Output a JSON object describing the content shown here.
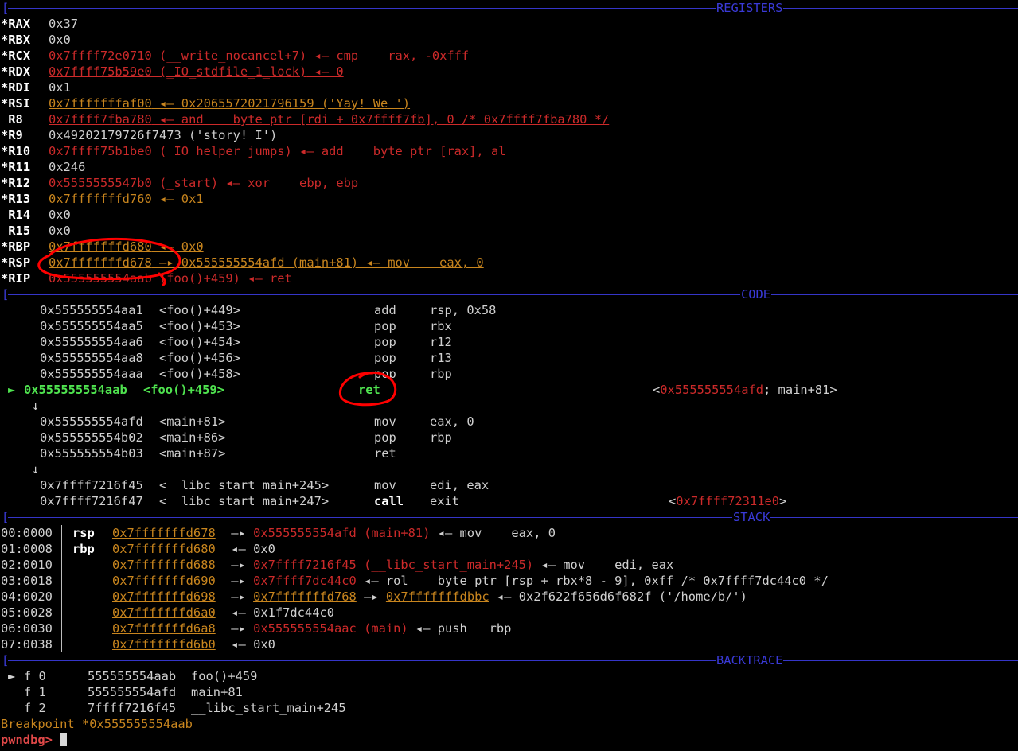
{
  "sections": {
    "registers": "REGISTERS",
    "code": "CODE",
    "stack": "STACK",
    "backtrace": "BACKTRACE"
  },
  "registers": [
    {
      "mod": "*",
      "name": "RAX",
      "value": "0x37",
      "vstyle": "plain",
      "rest": ""
    },
    {
      "mod": "*",
      "name": "RBX",
      "value": "0x0",
      "vstyle": "plain",
      "rest": ""
    },
    {
      "mod": "*",
      "name": "RCX",
      "value": "0x7ffff72e0710 (__write_nocancel+7)",
      "vstyle": "code",
      "rest": " ◂— cmp    rax, -0xfff"
    },
    {
      "mod": "*",
      "name": "RDX",
      "value": "0x7ffff75b59e0 (_IO_stdfile_1_lock)",
      "vstyle": "code-ul",
      "rest": " ◂— 0"
    },
    {
      "mod": "*",
      "name": "RDI",
      "value": "0x1",
      "vstyle": "plain",
      "rest": ""
    },
    {
      "mod": "*",
      "name": "RSI",
      "value": "0x7fffffffaf00",
      "vstyle": "stack",
      "rest": " ◂— 0x2065572021796159 ('Yay! We ')"
    },
    {
      "mod": " ",
      "name": "R8",
      "value": "0x7ffff7fba780",
      "vstyle": "code-ul",
      "rest": " ◂— and    byte ptr [rdi + 0x7ffff7fb], 0 /* 0x7ffff7fba780 */"
    },
    {
      "mod": "*",
      "name": "R9",
      "value": "0x49202179726f7473 ('story! I')",
      "vstyle": "plain",
      "rest": ""
    },
    {
      "mod": "*",
      "name": "R10",
      "value": "0x7ffff75b1be0 (_IO_helper_jumps)",
      "vstyle": "code",
      "rest": " ◂— add    byte ptr [rax], al"
    },
    {
      "mod": "*",
      "name": "R11",
      "value": "0x246",
      "vstyle": "plain",
      "rest": ""
    },
    {
      "mod": "*",
      "name": "R12",
      "value": "0x5555555547b0 (_start)",
      "vstyle": "code",
      "rest": " ◂— xor    ebp, ebp"
    },
    {
      "mod": "*",
      "name": "R13",
      "value": "0x7fffffffd760",
      "vstyle": "stack",
      "rest": " ◂— 0x1"
    },
    {
      "mod": " ",
      "name": "R14",
      "value": "0x0",
      "vstyle": "plain",
      "rest": ""
    },
    {
      "mod": " ",
      "name": "R15",
      "value": "0x0",
      "vstyle": "plain",
      "rest": ""
    },
    {
      "mod": "*",
      "name": "RBP",
      "value": "0x7fffffffd680",
      "vstyle": "stack",
      "rest": " ◂— 0x0"
    },
    {
      "mod": "*",
      "name": "RSP",
      "value": "0x7fffffffd678",
      "vstyle": "stack",
      "rest": " —▸ 0x555555554afd (main+81) ◂— mov    eax, 0"
    },
    {
      "mod": "*",
      "name": "RIP",
      "value": "0x555555554aab (foo()+459)",
      "vstyle": "code",
      "rest": " ◂— ret"
    }
  ],
  "code": [
    {
      "arrow": "",
      "addr": "0x555555554aa1",
      "sym": "<foo()+449>",
      "mnem": "add",
      "ops": "rsp, 0x58",
      "comment": ""
    },
    {
      "arrow": "",
      "addr": "0x555555554aa5",
      "sym": "<foo()+453>",
      "mnem": "pop",
      "ops": "rbx",
      "comment": ""
    },
    {
      "arrow": "",
      "addr": "0x555555554aa6",
      "sym": "<foo()+454>",
      "mnem": "pop",
      "ops": "r12",
      "comment": ""
    },
    {
      "arrow": "",
      "addr": "0x555555554aa8",
      "sym": "<foo()+456>",
      "mnem": "pop",
      "ops": "r13",
      "comment": ""
    },
    {
      "arrow": "",
      "addr": "0x555555554aaa",
      "sym": "<foo()+458>",
      "mnem": "pop",
      "ops": "rbp",
      "comment": ""
    },
    {
      "arrow": "►",
      "addr": "0x555555554aab",
      "sym": "<foo()+459>",
      "mnem": "ret",
      "ops": "",
      "comment_pre": "<",
      "comment_addr": "0x555555554afd",
      "comment_post": "; main+81>",
      "current": true
    },
    {
      "flow": "↓"
    },
    {
      "arrow": "",
      "addr": "0x555555554afd",
      "sym": "<main+81>",
      "mnem": "mov",
      "ops": "eax, 0",
      "comment": ""
    },
    {
      "arrow": "",
      "addr": "0x555555554b02",
      "sym": "<main+86>",
      "mnem": "pop",
      "ops": "rbp",
      "comment": ""
    },
    {
      "arrow": "",
      "addr": "0x555555554b03",
      "sym": "<main+87>",
      "mnem": "ret",
      "ops": "",
      "comment": ""
    },
    {
      "flow": "↓"
    },
    {
      "arrow": "",
      "addr": "0x7ffff7216f45",
      "sym": "<__libc_start_main+245>",
      "mnem": "mov",
      "ops": "edi, eax",
      "comment": ""
    },
    {
      "arrow": "",
      "addr": "0x7ffff7216f47",
      "sym": "<__libc_start_main+247>",
      "mnem": "call",
      "ops": "exit",
      "bold": true,
      "comment_pre": "<",
      "comment_addr": "0x7ffff72311e0",
      "comment_post": ">"
    }
  ],
  "stack": [
    {
      "idx": "00:0000",
      "reg": "rsp",
      "addr": "0x7fffffffd678",
      "chain": [
        {
          "t": " —▸ ",
          "c": "p"
        },
        {
          "t": "0x555555554afd (main+81)",
          "c": "r"
        },
        {
          "t": " ◂— mov    eax, 0",
          "c": "p"
        }
      ]
    },
    {
      "idx": "01:0008",
      "reg": "rbp",
      "addr": "0x7fffffffd680",
      "chain": [
        {
          "t": " ◂— 0x0",
          "c": "p"
        }
      ]
    },
    {
      "idx": "02:0010",
      "reg": "",
      "addr": "0x7fffffffd688",
      "chain": [
        {
          "t": " —▸ ",
          "c": "p"
        },
        {
          "t": "0x7ffff7216f45 (__libc_start_main+245)",
          "c": "r"
        },
        {
          "t": " ◂— mov    edi, eax",
          "c": "p"
        }
      ]
    },
    {
      "idx": "03:0018",
      "reg": "",
      "addr": "0x7fffffffd690",
      "chain": [
        {
          "t": " —▸ ",
          "c": "p"
        },
        {
          "t": "0x7ffff7dc44c0",
          "c": "ru"
        },
        {
          "t": " ◂— rol    byte ptr [rsp + rbx*8 - 9], 0xff /* 0x7ffff7dc44c0 */",
          "c": "p"
        }
      ]
    },
    {
      "idx": "04:0020",
      "reg": "",
      "addr": "0x7fffffffd698",
      "chain": [
        {
          "t": " —▸ ",
          "c": "p"
        },
        {
          "t": "0x7fffffffd768",
          "c": "o"
        },
        {
          "t": " —▸ ",
          "c": "p"
        },
        {
          "t": "0x7fffffffdbbc",
          "c": "o"
        },
        {
          "t": " ◂— 0x2f622f656d6f682f ('/home/b/')",
          "c": "p"
        }
      ]
    },
    {
      "idx": "05:0028",
      "reg": "",
      "addr": "0x7fffffffd6a0",
      "chain": [
        {
          "t": " ◂— 0x1f7dc44c0",
          "c": "p"
        }
      ]
    },
    {
      "idx": "06:0030",
      "reg": "",
      "addr": "0x7fffffffd6a8",
      "chain": [
        {
          "t": " —▸ ",
          "c": "p"
        },
        {
          "t": "0x555555554aac (main)",
          "c": "r"
        },
        {
          "t": " ◂— push   rbp",
          "c": "p"
        }
      ]
    },
    {
      "idx": "07:0038",
      "reg": "",
      "addr": "0x7fffffffd6b0",
      "chain": [
        {
          "t": " ◂— 0x0",
          "c": "p"
        }
      ]
    }
  ],
  "backtrace": [
    {
      "arrow": "►",
      "frame": "f 0",
      "addr": "555555554aab",
      "sym": "foo()+459"
    },
    {
      "arrow": "",
      "frame": "f 1",
      "addr": "555555554afd",
      "sym": "main+81"
    },
    {
      "arrow": "",
      "frame": "f 2",
      "addr": "7ffff7216f45",
      "sym": "__libc_start_main+245"
    }
  ],
  "breakpoint": "Breakpoint *0x555555554aab",
  "prompt": "pwndbg>",
  "colors": {
    "background": "#000000",
    "separator": "#3535c8",
    "code_addr": "#cc2a2a",
    "stack_addr": "#c8851e",
    "current_line": "#4fe34f",
    "prompt": "#e04848",
    "annotation": "#ff0000"
  }
}
